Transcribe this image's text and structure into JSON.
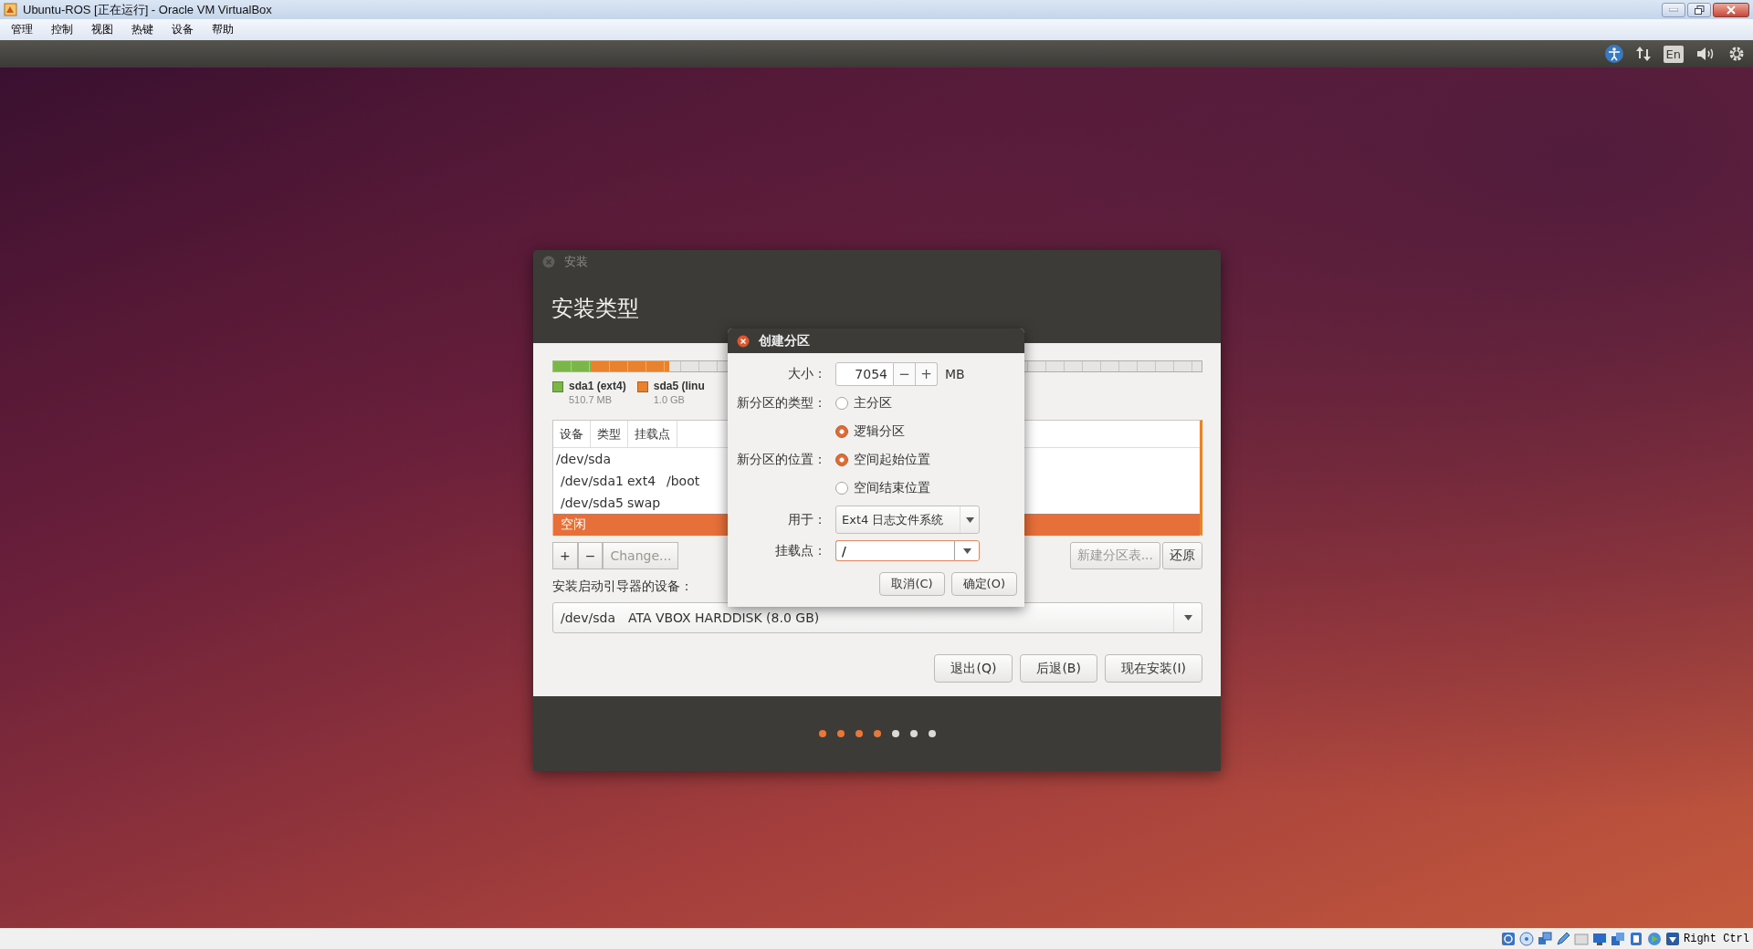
{
  "window": {
    "title": "Ubuntu-ROS [正在运行] - Oracle VM VirtualBox"
  },
  "menu": [
    "管理",
    "控制",
    "视图",
    "热键",
    "设备",
    "帮助"
  ],
  "top_panel": {
    "keyboard": "En"
  },
  "installer": {
    "title": "安装",
    "heading": "安装类型",
    "partition_bar": [
      {
        "color": "#7ab648",
        "level": 0.059
      },
      {
        "color": "#e8822e",
        "level": 0.12
      }
    ],
    "legend": [
      {
        "name": "sda1 (ext4)",
        "size": "510.7 MB",
        "color": "#7ab648"
      },
      {
        "name": "sda5 (linu",
        "size": "1.0 GB",
        "color": "#e8822e"
      }
    ],
    "table": {
      "columns": [
        "设备",
        "类型",
        "挂载点"
      ],
      "rows": [
        {
          "device": "/dev/sda",
          "selected": false,
          "children": [
            {
              "device": "/dev/sda1",
              "type": "ext4",
              "mount": "/boot",
              "selected": false
            },
            {
              "device": "/dev/sda5",
              "type": "swap",
              "selected": false
            },
            {
              "device": "空闲",
              "selected": true
            }
          ]
        }
      ]
    },
    "toolbar": [
      {
        "label": "+",
        "disabled": false
      },
      {
        "label": "−",
        "disabled": false
      },
      {
        "label": "Change...",
        "disabled": true
      }
    ],
    "table_buttons": [
      {
        "label": "新建分区表...",
        "disabled": true
      },
      {
        "label": "还原",
        "disabled": false
      }
    ],
    "bootloader": {
      "label": "安装启动引导器的设备：",
      "device": "/dev/sda",
      "description": "ATA VBOX HARDDISK (8.0 GB)"
    },
    "buttons": [
      "退出(Q)",
      "后退(B)",
      "现在安装(I)"
    ],
    "progress_dots": [
      {
        "done": true
      },
      {
        "done": true
      },
      {
        "done": true
      },
      {
        "done": true
      },
      {
        "done": false
      },
      {
        "done": false
      },
      {
        "done": false
      }
    ]
  },
  "dialog": {
    "title": "创建分区",
    "size_label": "大小：",
    "size": "7054",
    "minus": "−",
    "plus": "+",
    "unit": "MB",
    "type_label": "新分区的类型：",
    "types": [
      {
        "label": "主分区",
        "selected": false
      },
      {
        "label": "逻辑分区",
        "selected": true
      }
    ],
    "location_label": "新分区的位置：",
    "locations": [
      {
        "label": "空间起始位置",
        "selected": true
      },
      {
        "label": "空间结束位置",
        "selected": false
      }
    ],
    "use_label": "用于：",
    "use_value": "Ext4 日志文件系统",
    "mount_label": "挂载点：",
    "mount_value": "/",
    "buttons": [
      "取消(C)",
      "确定(O)"
    ]
  },
  "status_bar": {
    "host_key": "Right Ctrl"
  }
}
